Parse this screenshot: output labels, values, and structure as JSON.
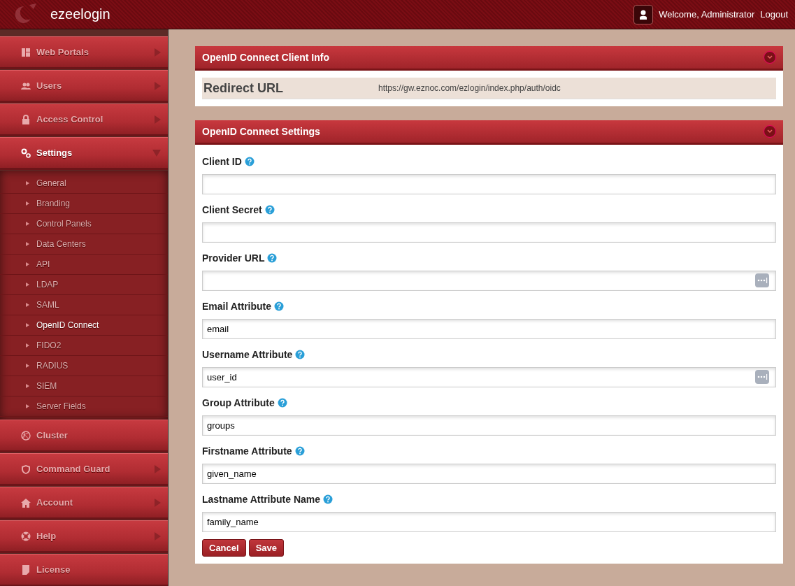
{
  "header": {
    "logo_text": "ezeelogin",
    "welcome": "Welcome, Administrator",
    "logout": "Logout"
  },
  "sidebar": {
    "items": [
      {
        "label": "Web Portals",
        "has_arrow": true,
        "expanded": false
      },
      {
        "label": "Users",
        "has_arrow": true,
        "expanded": false
      },
      {
        "label": "Access Control",
        "has_arrow": true,
        "expanded": false
      },
      {
        "label": "Settings",
        "has_arrow": true,
        "expanded": true,
        "children": [
          {
            "label": "General",
            "selected": false
          },
          {
            "label": "Branding",
            "selected": false
          },
          {
            "label": "Control Panels",
            "selected": false
          },
          {
            "label": "Data Centers",
            "selected": false
          },
          {
            "label": "API",
            "selected": false
          },
          {
            "label": "LDAP",
            "selected": false
          },
          {
            "label": "SAML",
            "selected": false
          },
          {
            "label": "OpenID Connect",
            "selected": true
          },
          {
            "label": "FIDO2",
            "selected": false
          },
          {
            "label": "RADIUS",
            "selected": false
          },
          {
            "label": "SIEM",
            "selected": false
          },
          {
            "label": "Server Fields",
            "selected": false
          }
        ]
      },
      {
        "label": "Cluster",
        "has_arrow": false,
        "expanded": false
      },
      {
        "label": "Command Guard",
        "has_arrow": true,
        "expanded": false
      },
      {
        "label": "Account",
        "has_arrow": true,
        "expanded": false
      },
      {
        "label": "Help",
        "has_arrow": true,
        "expanded": false
      },
      {
        "label": "License",
        "has_arrow": false,
        "expanded": false
      }
    ]
  },
  "client_info": {
    "title": "OpenID Connect Client Info",
    "redirect_label": "Redirect URL",
    "redirect_value": "https://gw.eznoc.com/ezlogin/index.php/auth/oidc"
  },
  "settings": {
    "title": "OpenID Connect Settings",
    "fields": [
      {
        "label": "Client ID",
        "autofill_icon": false
      },
      {
        "label": "Client Secret",
        "autofill_icon": false
      },
      {
        "label": "Provider URL",
        "autofill_icon": true
      },
      {
        "label": "Email Attribute",
        "value": "email",
        "autofill_icon": false
      },
      {
        "label": "Username Attribute",
        "value": "user_id",
        "autofill_icon": true
      },
      {
        "label": "Group Attribute",
        "value": "groups",
        "autofill_icon": false
      },
      {
        "label": "Firstname Attribute",
        "value": "given_name",
        "autofill_icon": false
      },
      {
        "label": "Lastname Attribute Name",
        "value": "family_name",
        "autofill_icon": false
      }
    ],
    "buttons": [
      "Cancel",
      "Save"
    ]
  }
}
